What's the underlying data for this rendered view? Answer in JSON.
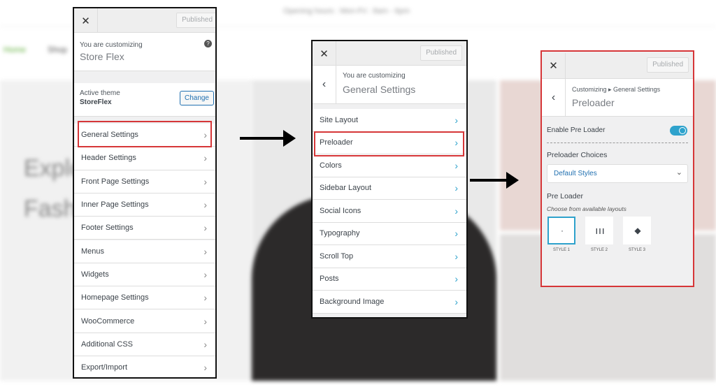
{
  "background": {
    "topbar": "Opening hours : Mon-Fri : 8am - 6pm",
    "nav": [
      "Home",
      "Shop"
    ],
    "hero_lines": [
      "Explo",
      "Fashi"
    ]
  },
  "panel1": {
    "close": "✕",
    "published": "Published",
    "customizing": "You are customizing",
    "site": "Store Flex",
    "active_theme_label": "Active theme",
    "active_theme": "StoreFlex",
    "change": "Change",
    "help": "?",
    "items": [
      "General Settings",
      "Header Settings",
      "Front Page Settings",
      "Inner Page Settings",
      "Footer Settings",
      "Menus",
      "Widgets",
      "Homepage Settings",
      "WooCommerce",
      "Additional CSS",
      "Export/Import"
    ]
  },
  "panel2": {
    "close": "✕",
    "published": "Published",
    "customizing": "You are customizing",
    "section": "General Settings",
    "items": [
      "Site Layout",
      "Preloader",
      "Colors",
      "Sidebar Layout",
      "Social Icons",
      "Typography",
      "Scroll Top",
      "Posts",
      "Background Image"
    ]
  },
  "panel3": {
    "close": "✕",
    "published": "Published",
    "breadcrumb": "Customizing ▸ General Settings",
    "title": "Preloader",
    "enable_label": "Enable Pre Loader",
    "enable_on": true,
    "choices_label": "Preloader Choices",
    "choice_value": "Default Styles",
    "preloader_label": "Pre Loader",
    "preloader_desc": "Choose from available layouts",
    "styles": [
      "STYLE 1",
      "STYLE 2",
      "STYLE 3"
    ],
    "selected_style": "STYLE 1"
  },
  "colors": {
    "accent": "#2ea2cc",
    "highlight": "#d63638"
  }
}
